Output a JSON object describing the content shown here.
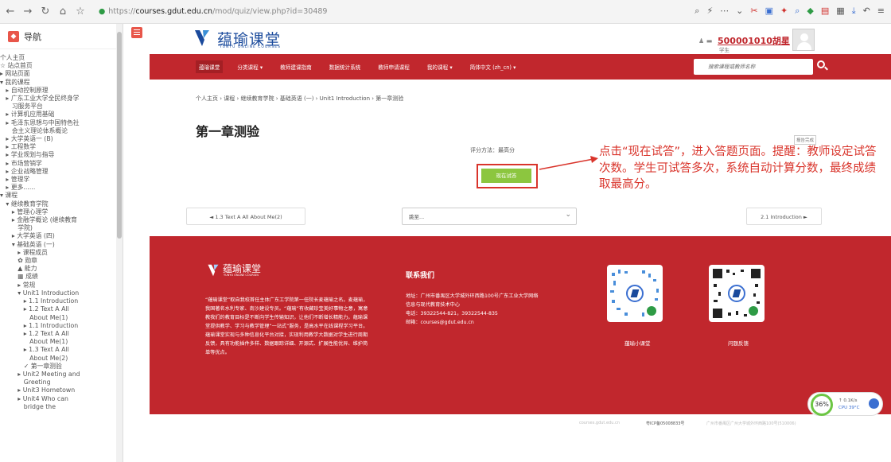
{
  "browser": {
    "url_scheme": "https://",
    "url_host": "courses.gdut.edu.cn",
    "url_path": "/mod/quiz/view.php?id=30489"
  },
  "sidebar": {
    "title": "导航",
    "tree": [
      "个人主页",
      "☆ 站点首页",
      "▸ 网站页面",
      "▾ 我的课程",
      "   ▸ 自动控制原理",
      "   ▸ 广东工业大学全民终身学",
      "      习服务平台",
      "   ▸ 计算机应用基础",
      "   ▸ 毛泽东思想与中国特色社",
      "      会主义理论体系概论",
      "   ▸ 大学英语一 (B)",
      "   ▸ 工程数学",
      "   ▸ 学业规划与指导",
      "   ▸ 市场营销学",
      "   ▸ 企业战略管理",
      "   ▸ 管理学",
      "   ▸ 更多......",
      "▾ 课程",
      "   ▾ 继续教育学院",
      "      ▸ 管理心理学",
      "      ▸ 金融学概论 (继续教育",
      "         学院)",
      "      ▸ 大学英语 (四)",
      "      ▾ 基础英语 (一)",
      "         ▸ 课程成员",
      "         ✿ 勋章",
      "         ▲ 能力",
      "         ▦ 成绩",
      "         ▸ 常规",
      "         ▾ Unit1 Introduction",
      "            ▸ 1.1 Introduction",
      "            ▸ 1.2 Text A All",
      "               About Me(1)",
      "            ▸ 1.1 Introduction",
      "            ▸ 1.2 Text A All",
      "               About Me(1)",
      "            ▸ 1.3 Text A All",
      "               About Me(2)",
      "            ✓ 第一章测验",
      "         ▸ Unit2 Meeting and",
      "            Greeting",
      "         ▸ Unit3 Hometown",
      "         ▸ Unit4 Who can",
      "            bridge the"
    ]
  },
  "header": {
    "logo_text": "蕴瑜课堂",
    "logo_sub": "YUNYU ONLINE COURSES",
    "user_name": "500001010胡星",
    "user_role": "学生"
  },
  "menu": {
    "items": [
      "蕴瑜课堂",
      "分类课程 ▾",
      "教师建课指南",
      "数据统计系统",
      "教师申请课程",
      "我的课程 ▾",
      "简体中文 (zh_cn) ▾"
    ],
    "search_placeholder": "搜索课程或教师名称"
  },
  "main": {
    "breadcrumb": "个人主页 › 课程 › 继续教育学院 › 基础英语 (一) › Unit1 Introduction › 第一章测验",
    "page_title": "第一章测验",
    "report_button": "报告完成",
    "grade_method": "评分方法：最高分",
    "attempt_button": "现在试答",
    "prev_link": "◄ 1.3 Text A All About Me(2)",
    "jump_label": "跳至...",
    "next_link": "2.1 Introduction ►"
  },
  "annotation": {
    "text": "点击“现在试答”，进入答题页面。提醒：教师设定试答次数。学生可试答多次，系统自动计算分数，最终成绩取最高分。",
    "color": "#d9342b"
  },
  "footer": {
    "logo_text": "蕴瑜课堂",
    "logo_sub": "YUNYU ONLINE COURSES",
    "about": "“蕴瑜课堂”取自我校首任主体广东工学院第一任院长麦蕴瑜之名。麦蕴瑜，我国著名水利专家、南沙建设专员。“蕴瑜”有收藏珍宝美好事物之意，寓意教我们的教育目标是不断向学生传输知识，让他们不断增长精能力。蕴瑜课堂提供教学、学习与教学管理“一站式”服务，是高水平在线课程学习平台。蕴瑜课堂实现与多种信息化平台对接，实现利用教学大数据对学生进行周期反馈，具有功能插件多样、数据跟踪详细、开源式、扩展性能优异、维护简单等优点。",
    "contact_title": "联系我们",
    "contact": "地址：广州市番禺区大学城外环西路100号广东工业大学网络信息与现代教育技术中心\n电话：39322544-821，39322544-835\n邮箱：courses@gdut.edu.cn",
    "qr1_label": "蕴瑜小课堂",
    "qr2_label": "问题反馈",
    "icp_host": "courses.gdut.edu.cn",
    "icp_number": "粤ICP备05008833号",
    "icp_address": "广州市番禺区广州大学城外环西路100号(510006)"
  },
  "perf": {
    "percent": "36%",
    "net": "↑ 0.1K/s",
    "cpu": "CPU 39°C"
  },
  "colors": {
    "brand_red": "#c1272d",
    "brand_blue": "#1a4a9c",
    "attempt_green": "#8cc63f"
  }
}
